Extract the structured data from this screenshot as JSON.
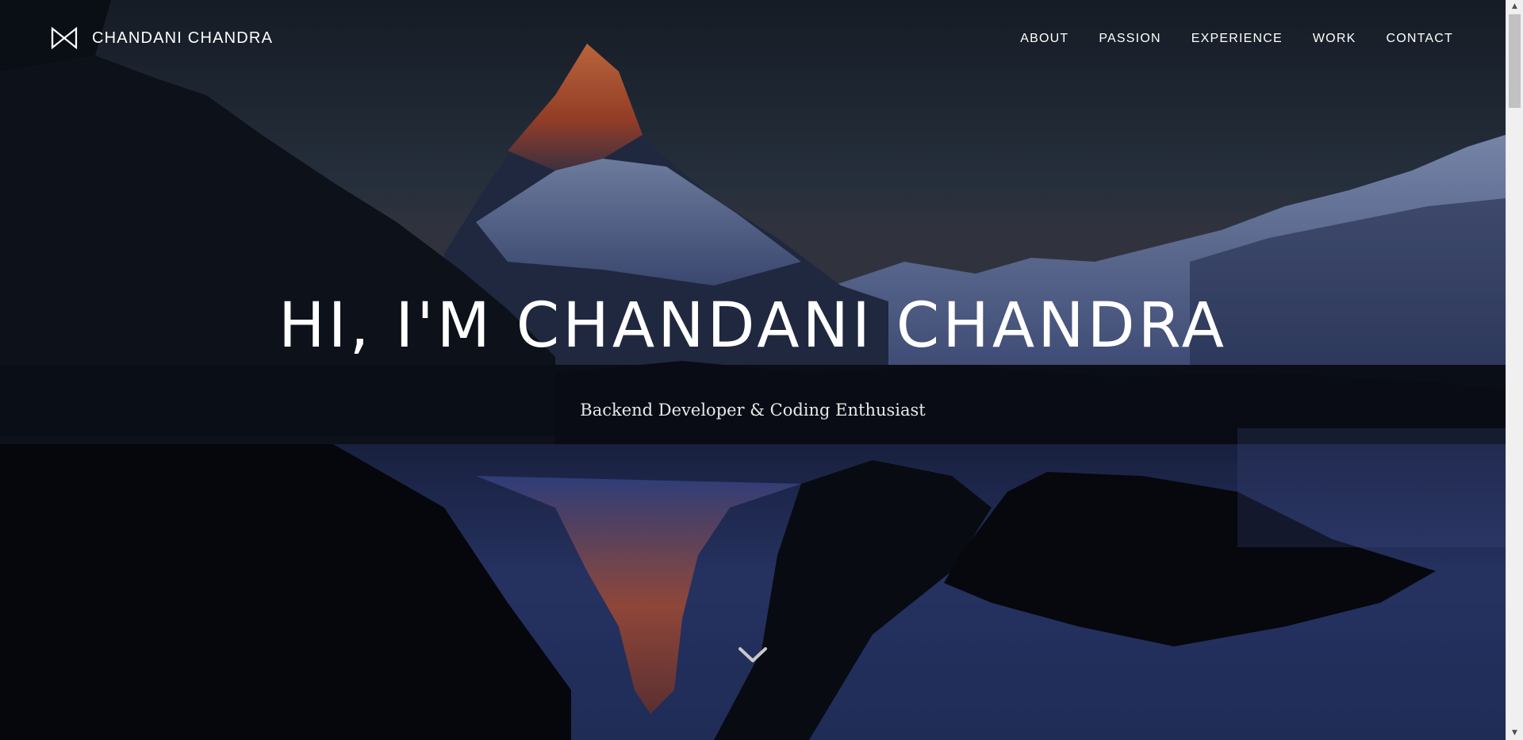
{
  "navbar": {
    "brand_name": "CHANDANI CHANDRA",
    "brand_icon": "bowtie-logo-icon",
    "links": [
      "ABOUT",
      "PASSION",
      "EXPERIENCE",
      "WORK",
      "CONTACT"
    ]
  },
  "hero": {
    "title": "HI, I'M CHANDANI CHANDRA",
    "subtitle": "Backend Developer & Coding Enthusiast",
    "scroll_icon": "chevron-down-icon"
  },
  "colors": {
    "text": "#ffffff",
    "sky_top": "#1c232c",
    "sky_bottom": "#2d3a47",
    "peak_glow": "#d8673a",
    "water": "#2c3a6e"
  },
  "scrollbar": {
    "up_glyph": "▲",
    "down_glyph": "▼"
  }
}
